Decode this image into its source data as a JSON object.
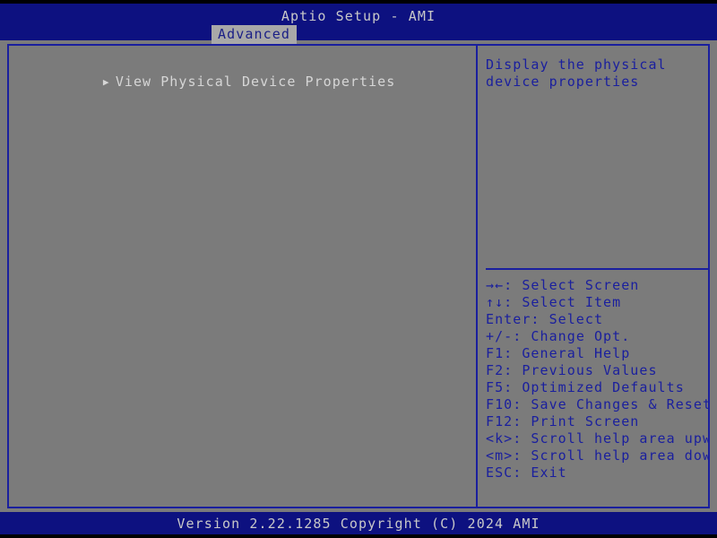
{
  "app": {
    "title": "Aptio Setup - AMI"
  },
  "colors": {
    "header_blue": "#0d1180",
    "border_blue": "#1a1f9e",
    "panel_gray": "#7b7b7b",
    "tab_gray": "#a8a8a8",
    "text_light": "#d6d6d6",
    "text_blue": "#1a1f9e",
    "letterbox_black": "#000000"
  },
  "tabs": [
    {
      "label": "Advanced",
      "selected": true
    }
  ],
  "menu": {
    "items": [
      {
        "arrow_icon": "triangle-right-icon",
        "arrow_glyph": "▶",
        "label": "View Physical Device Properties",
        "selected": true
      }
    ]
  },
  "help": {
    "description": "Display the physical device properties",
    "keys": [
      {
        "glyph": "→←",
        "text": ": Select Screen"
      },
      {
        "glyph": "↑↓",
        "text": ": Select Item"
      },
      {
        "glyph": "Enter",
        "text": ": Select"
      },
      {
        "glyph": "+/-",
        "text": ": Change Opt."
      },
      {
        "glyph": "F1",
        "text": ": General Help"
      },
      {
        "glyph": "F2",
        "text": ": Previous Values"
      },
      {
        "glyph": "F5",
        "text": ": Optimized Defaults"
      },
      {
        "glyph": "F10",
        "text": ": Save Changes & Reset"
      },
      {
        "glyph": "F12",
        "text": ": Print Screen"
      },
      {
        "glyph": "<k>",
        "text": ": Scroll help area upwards"
      },
      {
        "glyph": "<m>",
        "text": ": Scroll help area downwards"
      },
      {
        "glyph": "ESC",
        "text": ": Exit"
      }
    ]
  },
  "footer": {
    "version_text": "Version 2.22.1285 Copyright (C) 2024 AMI"
  }
}
